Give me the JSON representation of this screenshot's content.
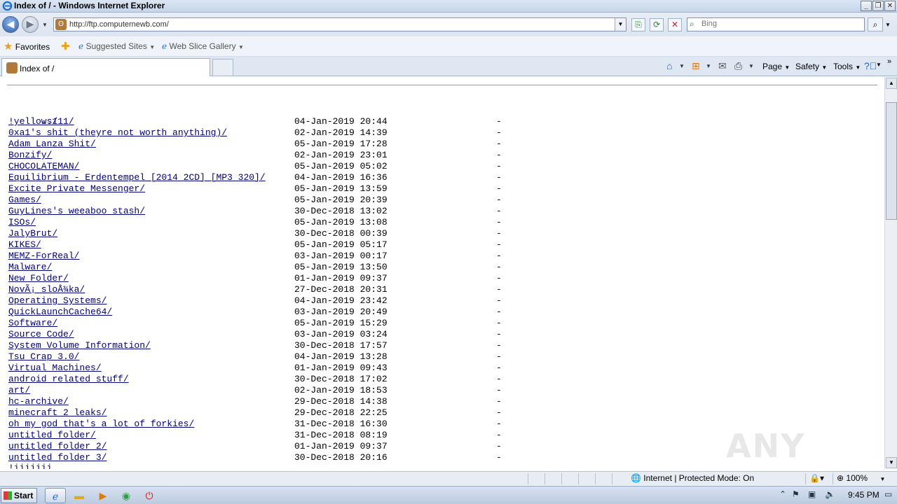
{
  "window": {
    "title": "Index of / - Windows Internet Explorer"
  },
  "address": {
    "url": "http://ftp.computernewb.com/"
  },
  "search": {
    "placeholder": "Bing"
  },
  "favorites_bar": {
    "favorites_label": "Favorites",
    "suggested_sites": "Suggested Sites",
    "web_slice_gallery": "Web Slice Gallery"
  },
  "tab": {
    "title": "Index of /"
  },
  "command_bar": {
    "page": "Page",
    "safety": "Safety",
    "tools": "Tools"
  },
  "listing": {
    "parent": "../",
    "rows": [
      {
        "name": "!yellows111/",
        "date": "04-Jan-2019 20:44",
        "size": "-"
      },
      {
        "name": "0xa1's shit (theyre not worth anything)/",
        "date": "02-Jan-2019 14:39",
        "size": "-"
      },
      {
        "name": "Adam Lanza Shit/",
        "date": "05-Jan-2019 17:28",
        "size": "-"
      },
      {
        "name": "Bonzify/",
        "date": "02-Jan-2019 23:01",
        "size": "-"
      },
      {
        "name": "CHOCOLATEMAN/",
        "date": "05-Jan-2019 05:02",
        "size": "-"
      },
      {
        "name": "Equilibrium - Erdentempel [2014 2CD] [MP3 320]/",
        "date": "04-Jan-2019 16:36",
        "size": "-"
      },
      {
        "name": "Excite Private Messenger/",
        "date": "05-Jan-2019 13:59",
        "size": "-"
      },
      {
        "name": "Games/",
        "date": "05-Jan-2019 20:39",
        "size": "-"
      },
      {
        "name": "GuyLines's weeaboo stash/",
        "date": "30-Dec-2018 13:02",
        "size": "-"
      },
      {
        "name": "ISOs/",
        "date": "05-Jan-2019 13:08",
        "size": "-"
      },
      {
        "name": "JalyBrut/",
        "date": "30-Dec-2018 00:39",
        "size": "-"
      },
      {
        "name": "KIKES/",
        "date": "05-Jan-2019 05:17",
        "size": "-"
      },
      {
        "name": "MEMZ-ForReal/",
        "date": "03-Jan-2019 00:17",
        "size": "-"
      },
      {
        "name": "Malware/",
        "date": "05-Jan-2019 13:50",
        "size": "-"
      },
      {
        "name": "New Folder/",
        "date": "01-Jan-2019 09:37",
        "size": "-"
      },
      {
        "name": "NovÃ¡ sloÅ¾ka/",
        "date": "27-Dec-2018 20:31",
        "size": "-"
      },
      {
        "name": "Operating Systems/",
        "date": "04-Jan-2019 23:42",
        "size": "-"
      },
      {
        "name": "QuickLaunchCache64/",
        "date": "03-Jan-2019 20:49",
        "size": "-"
      },
      {
        "name": "Software/",
        "date": "05-Jan-2019 15:29",
        "size": "-"
      },
      {
        "name": "Source Code/",
        "date": "03-Jan-2019 03:24",
        "size": "-"
      },
      {
        "name": "System Volume Information/",
        "date": "30-Dec-2018 17:57",
        "size": "-"
      },
      {
        "name": "Tsu Crap 3.0/",
        "date": "04-Jan-2019 13:28",
        "size": "-"
      },
      {
        "name": "Virtual Machines/",
        "date": "01-Jan-2019 09:43",
        "size": "-"
      },
      {
        "name": "android related stuff/",
        "date": "30-Dec-2018 17:02",
        "size": "-"
      },
      {
        "name": "art/",
        "date": "02-Jan-2019 18:53",
        "size": "-"
      },
      {
        "name": "hc-archive/",
        "date": "29-Dec-2018 14:38",
        "size": "-"
      },
      {
        "name": "minecraft 2 leaks/",
        "date": "29-Dec-2018 22:25",
        "size": "-"
      },
      {
        "name": "oh my god that's a lot of forkies/",
        "date": "31-Dec-2018 16:30",
        "size": "-"
      },
      {
        "name": "untitled folder/",
        "date": "31-Dec-2018 08:19",
        "size": "-"
      },
      {
        "name": "untitled folder 2/",
        "date": "01-Jan-2019 09:37",
        "size": "-"
      },
      {
        "name": "untitled folder 3/",
        "date": "30-Dec-2018 20:16",
        "size": "-"
      }
    ]
  },
  "statusbar": {
    "zone": "Internet | Protected Mode: On",
    "zoom": "100%"
  },
  "taskbar": {
    "start": "Start",
    "clock": "9:45 PM"
  },
  "watermark": "ANY RUN"
}
